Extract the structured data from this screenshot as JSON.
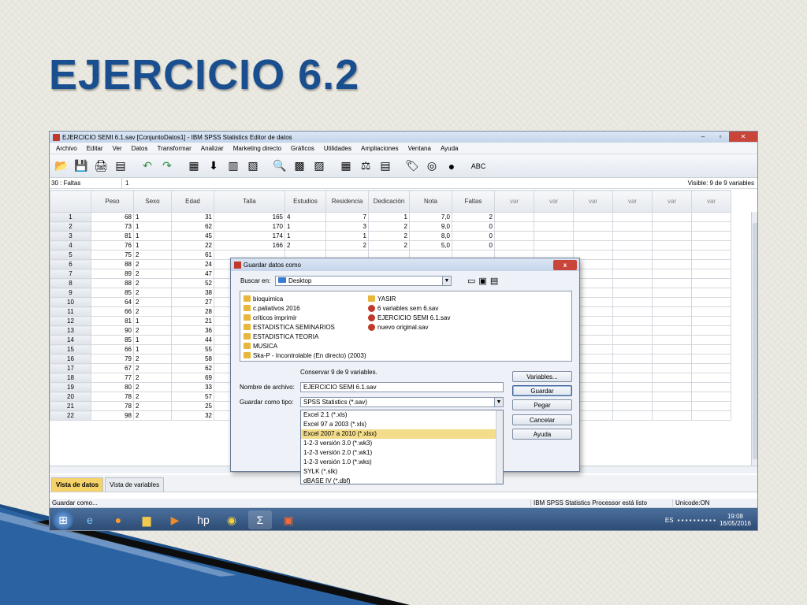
{
  "slide": {
    "title": "EJERCICIO 6.2"
  },
  "window": {
    "title": "EJERCICIO SEMI 6.1.sav [ConjuntoDatos1] - IBM SPSS Statistics Editor de datos",
    "minimize": "–",
    "restore": "▫",
    "close": "✕"
  },
  "menu": [
    "Archivo",
    "Editar",
    "Ver",
    "Datos",
    "Transformar",
    "Analizar",
    "Marketing directo",
    "Gráficos",
    "Utilidades",
    "Ampliaciones",
    "Ventana",
    "Ayuda"
  ],
  "cellbar": {
    "ref": "30 : Faltas",
    "value": "1",
    "visible": "Visible: 9 de 9 variables"
  },
  "columns": [
    "Peso",
    "Sexo",
    "Edad",
    "Talla",
    "Estudios",
    "Residencia",
    "Dedicación",
    "Nota",
    "Faltas",
    "var",
    "var",
    "var",
    "var",
    "var",
    "var"
  ],
  "rows": [
    [
      "1",
      "68",
      "1",
      "31",
      "165",
      "4",
      "7",
      "1",
      "7,0",
      "2"
    ],
    [
      "2",
      "73",
      "1",
      "62",
      "170",
      "1",
      "3",
      "2",
      "9,0",
      "0"
    ],
    [
      "3",
      "81",
      "1",
      "45",
      "174",
      "1",
      "1",
      "2",
      "8,0",
      "0"
    ],
    [
      "4",
      "76",
      "1",
      "22",
      "166",
      "2",
      "2",
      "2",
      "5,0",
      "0"
    ],
    [
      "5",
      "75",
      "2",
      "61",
      "",
      "",
      "",
      "",
      "",
      ""
    ],
    [
      "6",
      "88",
      "2",
      "24",
      "",
      "",
      "",
      "",
      "",
      ""
    ],
    [
      "7",
      "89",
      "2",
      "47",
      "",
      "",
      "",
      "",
      "",
      ""
    ],
    [
      "8",
      "88",
      "2",
      "52",
      "",
      "",
      "",
      "",
      "",
      ""
    ],
    [
      "9",
      "85",
      "2",
      "38",
      "",
      "",
      "",
      "",
      "",
      ""
    ],
    [
      "10",
      "64",
      "2",
      "27",
      "",
      "",
      "",
      "",
      "",
      ""
    ],
    [
      "11",
      "66",
      "2",
      "28",
      "",
      "",
      "",
      "",
      "",
      ""
    ],
    [
      "12",
      "81",
      "1",
      "21",
      "",
      "",
      "",
      "",
      "",
      ""
    ],
    [
      "13",
      "90",
      "2",
      "36",
      "",
      "",
      "",
      "",
      "",
      ""
    ],
    [
      "14",
      "85",
      "1",
      "44",
      "",
      "",
      "",
      "",
      "",
      ""
    ],
    [
      "15",
      "66",
      "1",
      "55",
      "",
      "",
      "",
      "",
      "",
      ""
    ],
    [
      "16",
      "79",
      "2",
      "58",
      "",
      "",
      "",
      "",
      "",
      ""
    ],
    [
      "17",
      "67",
      "2",
      "62",
      "",
      "",
      "",
      "",
      "",
      ""
    ],
    [
      "18",
      "77",
      "2",
      "69",
      "",
      "",
      "",
      "",
      "",
      ""
    ],
    [
      "19",
      "80",
      "2",
      "33",
      "",
      "",
      "",
      "",
      "",
      ""
    ],
    [
      "20",
      "78",
      "2",
      "57",
      "",
      "",
      "",
      "",
      "",
      ""
    ],
    [
      "21",
      "78",
      "2",
      "25",
      "",
      "",
      "",
      "",
      "",
      ""
    ],
    [
      "22",
      "98",
      "2",
      "32",
      "",
      "",
      "",
      "",
      "",
      ""
    ]
  ],
  "tabs": {
    "data_view": "Vista de datos",
    "variable_view": "Vista de variables"
  },
  "status": {
    "left": "Guardar como...",
    "processor": "IBM SPSS Statistics Processor está listo",
    "unicode": "Unicode:ON"
  },
  "taskbar": {
    "lang": "ES",
    "time": "19:08",
    "date": "16/05/2016"
  },
  "dialog": {
    "title": "Guardar datos como",
    "close": "x",
    "look_in_label": "Buscar en:",
    "look_in_value": "Desktop",
    "files_left": [
      "bioquimica",
      "c.paliativos 2016",
      "criticos imprimir",
      "ESTADISTICA SEMINARIOS",
      "ESTADISTICA TEORIA",
      "MUSICA",
      "Ska-P - Incontrolable (En directo) (2003)"
    ],
    "files_right_folder": "YASIR",
    "files_right_sav": [
      "6 variables sem 6.sav",
      "EJERCICIO SEMI 6.1.sav",
      "nuevo original.sav"
    ],
    "keep_vars": "Conservar 9 de 9 variables.",
    "filename_label": "Nombre de archivo:",
    "filename_value": "EJERCICIO SEMI 6.1.sav",
    "savetype_label": "Guardar como tipo:",
    "savetype_value": "SPSS Statistics (*.sav)",
    "type_options": [
      "Excel 2.1 (*.xls)",
      "Excel 97 a 2003 (*.xls)",
      "Excel 2007 a 2010 (*.xlsx)",
      "1-2-3 versión 3.0 (*.wk3)",
      "1-2-3 versión 2.0 (*.wk1)",
      "1-2-3 versión 1.0 (*.wks)",
      "SYLK (*.slk)",
      "dBASE IV (*.dbf)"
    ],
    "selected_option_index": 2,
    "buttons": {
      "variables": "Variables...",
      "save": "Guardar",
      "paste": "Pegar",
      "cancel": "Cancelar",
      "help": "Ayuda"
    }
  }
}
